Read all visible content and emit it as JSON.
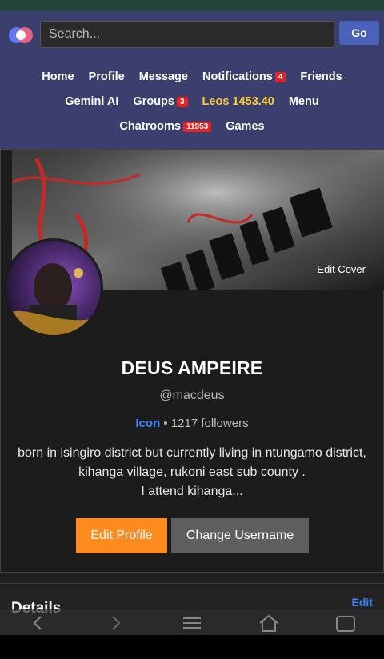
{
  "search": {
    "placeholder": "Search...",
    "go_label": "Go"
  },
  "nav": {
    "row1": [
      {
        "label": "Home"
      },
      {
        "label": "Profile"
      },
      {
        "label": "Message"
      },
      {
        "label": "Notifications",
        "badge": "4"
      },
      {
        "label": "Friends"
      }
    ],
    "row2": [
      {
        "label": "Gemini AI"
      },
      {
        "label": "Groups",
        "badge": "3"
      },
      {
        "label": "Leos 1453.40"
      },
      {
        "label": "Menu"
      }
    ],
    "row3": [
      {
        "label": "Chatrooms",
        "badge": "11953"
      },
      {
        "label": "Games"
      }
    ]
  },
  "cover": {
    "edit_label": "Edit Cover"
  },
  "profile": {
    "name": "DEUS AMPEIRE",
    "handle": "@macdeus",
    "rank": "Icon",
    "followers_text": "• 1217 followers",
    "bio_line1": "born in isingiro district but currently living in ntungamo district, kihanga village, rukoni east sub county .",
    "bio_line2": "I attend kihanga...",
    "edit_profile_label": "Edit Profile",
    "change_username_label": "Change Username"
  },
  "details": {
    "title": "Details",
    "edit_label": "Edit"
  },
  "colors": {
    "header_bg": "#3a3f6e",
    "accent_orange": "#ff8a1e",
    "link_blue": "#3a86ff",
    "badge_red": "#e02424",
    "leos_gold": "#ffcc33"
  }
}
